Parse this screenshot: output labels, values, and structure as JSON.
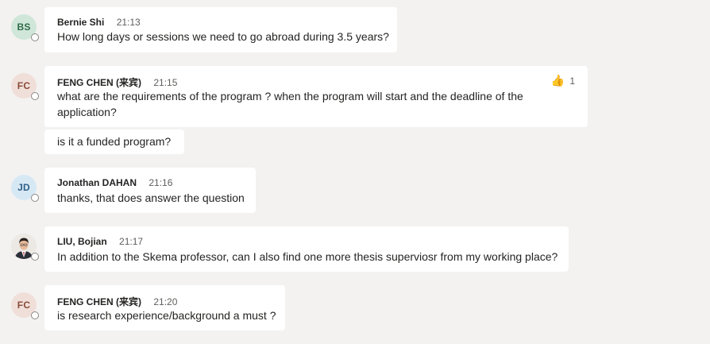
{
  "messages": [
    {
      "initials": "BS",
      "author": "Bernie Shi",
      "time": "21:13",
      "text": "How long days or sessions we need to go abroad during 3.5 years?"
    },
    {
      "initials": "FC",
      "author": "FENG CHEN (来宾)",
      "time": "21:15",
      "text_line1": "what are the requirements of the program ? when the program will start  and the deadline of the",
      "text_line2": "application?",
      "reaction_icon": "thumbs-up-icon",
      "reaction_count": "1",
      "followup": "is it a funded program?"
    },
    {
      "initials": "JD",
      "author": "Jonathan DAHAN",
      "time": "21:16",
      "text": "thanks, that does answer the question"
    },
    {
      "author": "LIU, Bojian",
      "time": "21:17",
      "text": "In addition to the Skema professor, can I also find one more thesis superviosr from my working place?"
    },
    {
      "initials": "FC",
      "author": "FENG CHEN (来宾)",
      "time": "21:20",
      "text": "is research experience/background a must ?"
    }
  ],
  "colors": {
    "background": "#f3f2f1",
    "bubble": "#ffffff",
    "avatar_bs_bg": "#cfe6d8",
    "avatar_bs_fg": "#2e6b4a",
    "avatar_fc_bg": "#f0dfd9",
    "avatar_fc_fg": "#8a4a3a",
    "avatar_jd_bg": "#d7e8f5",
    "avatar_jd_fg": "#2d5f85"
  }
}
